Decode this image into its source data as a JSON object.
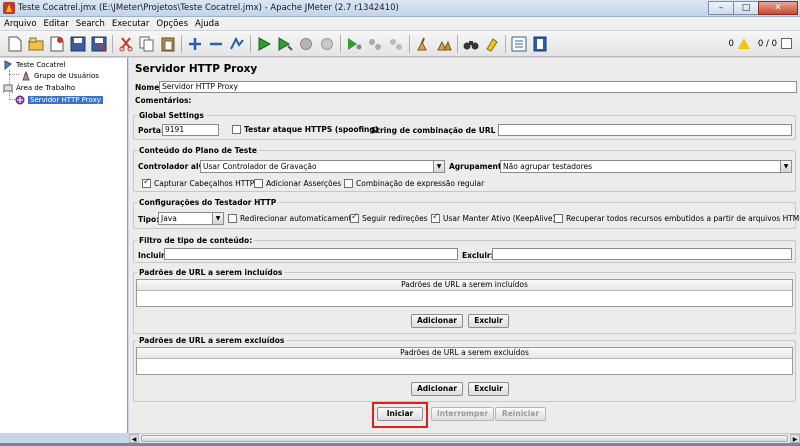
{
  "window": {
    "title": "Teste Cocatrel.jmx (E:\\JMeter\\Projetos\\Teste Cocatrel.jmx) - Apache JMeter (2.7 r1342410)",
    "minimize": "–",
    "maximize": "□",
    "close": "✕"
  },
  "menu": [
    "Arquivo",
    "Editar",
    "Search",
    "Executar",
    "Opções",
    "Ajuda"
  ],
  "toolbar": {
    "warnings_count": "0",
    "threads": "0 / 0"
  },
  "tree": {
    "test_plan": "Teste Cocatrel",
    "thread_group": "Grupo de Usuários",
    "workbench": "Área de Trabalho",
    "proxy": "Servidor HTTP Proxy"
  },
  "main": {
    "title": "Servidor HTTP Proxy",
    "name_label": "Nome:",
    "name_value": "Servidor HTTP Proxy",
    "comments_label": "Comentários:",
    "global": {
      "title": "Global Settings",
      "port_label": "Porta:",
      "port_value": "9191",
      "https_label": "Testar ataque  HTTPS (spoofing)",
      "url_match_label": "String de combinação de URL opcional:"
    },
    "plan": {
      "title": "Conteúdo do Plano de Teste",
      "target_label": "Controlador alvo:",
      "target_value": "Usar Controlador de Gravação",
      "grouping_label": "Agrupamento:",
      "grouping_value": "Não agrupar testadores",
      "capture_headers": "Capturar Cabeçalhos HTTP",
      "add_assertions": "Adicionar Asserções",
      "regex_matching": "Combinação de expressão regular"
    },
    "sampler": {
      "title": "Configurações do Testador HTTP",
      "type_label": "Tipo:",
      "type_value": "Java",
      "auto_redirect": "Redirecionar automaticamente",
      "follow_redirects": "Seguir redireções",
      "keepalive": "Usar Manter Ativo (KeepAlive)",
      "retrieve_embedded": "Recuperar todos recursos embutidos a partir de arquivos HTML"
    },
    "filter": {
      "title": "Filtro de tipo de conteúdo:",
      "include_label": "Incluir:",
      "exclude_label": "Excluir:"
    },
    "include_patterns": {
      "title": "Padrões de URL a serem incluídos",
      "header": "Padrões de URL a serem incluídos",
      "add": "Adicionar",
      "remove": "Excluir"
    },
    "exclude_patterns": {
      "title": "Padrões de URL a serem excluídos",
      "header": "Padrões de URL a serem excluídos",
      "add": "Adicionar",
      "remove": "Excluir"
    },
    "start": "Iniciar",
    "stop": "Interromper",
    "restart": "Reiniciar"
  }
}
